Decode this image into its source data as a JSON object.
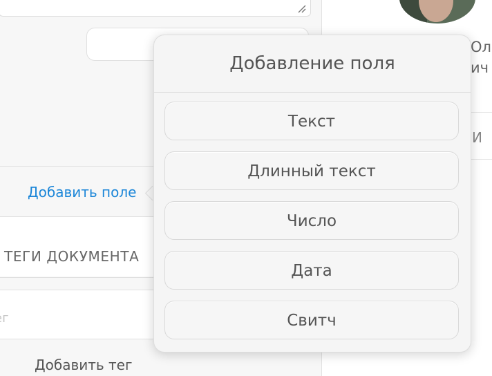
{
  "form": {
    "add_field_link": "Добавить поле",
    "tags_title": "ТЕГИ ДОКУМЕНТА",
    "tag_input_placeholder": "ег",
    "add_tag_button": "Добавить тег"
  },
  "sidebar": {
    "user_name_partial_line1": "Ол",
    "user_name_partial_line2": "ич",
    "label_partial": "И"
  },
  "popover": {
    "title": "Добавление поля",
    "options": [
      {
        "label": "Текст"
      },
      {
        "label": "Длинный текст"
      },
      {
        "label": "Число"
      },
      {
        "label": "Дата"
      },
      {
        "label": "Свитч"
      }
    ]
  },
  "colors": {
    "link": "#1b86d8",
    "panel_bg": "#f7f7f7",
    "popover_bg": "#f5f5f5",
    "border": "#d9d9d9"
  }
}
